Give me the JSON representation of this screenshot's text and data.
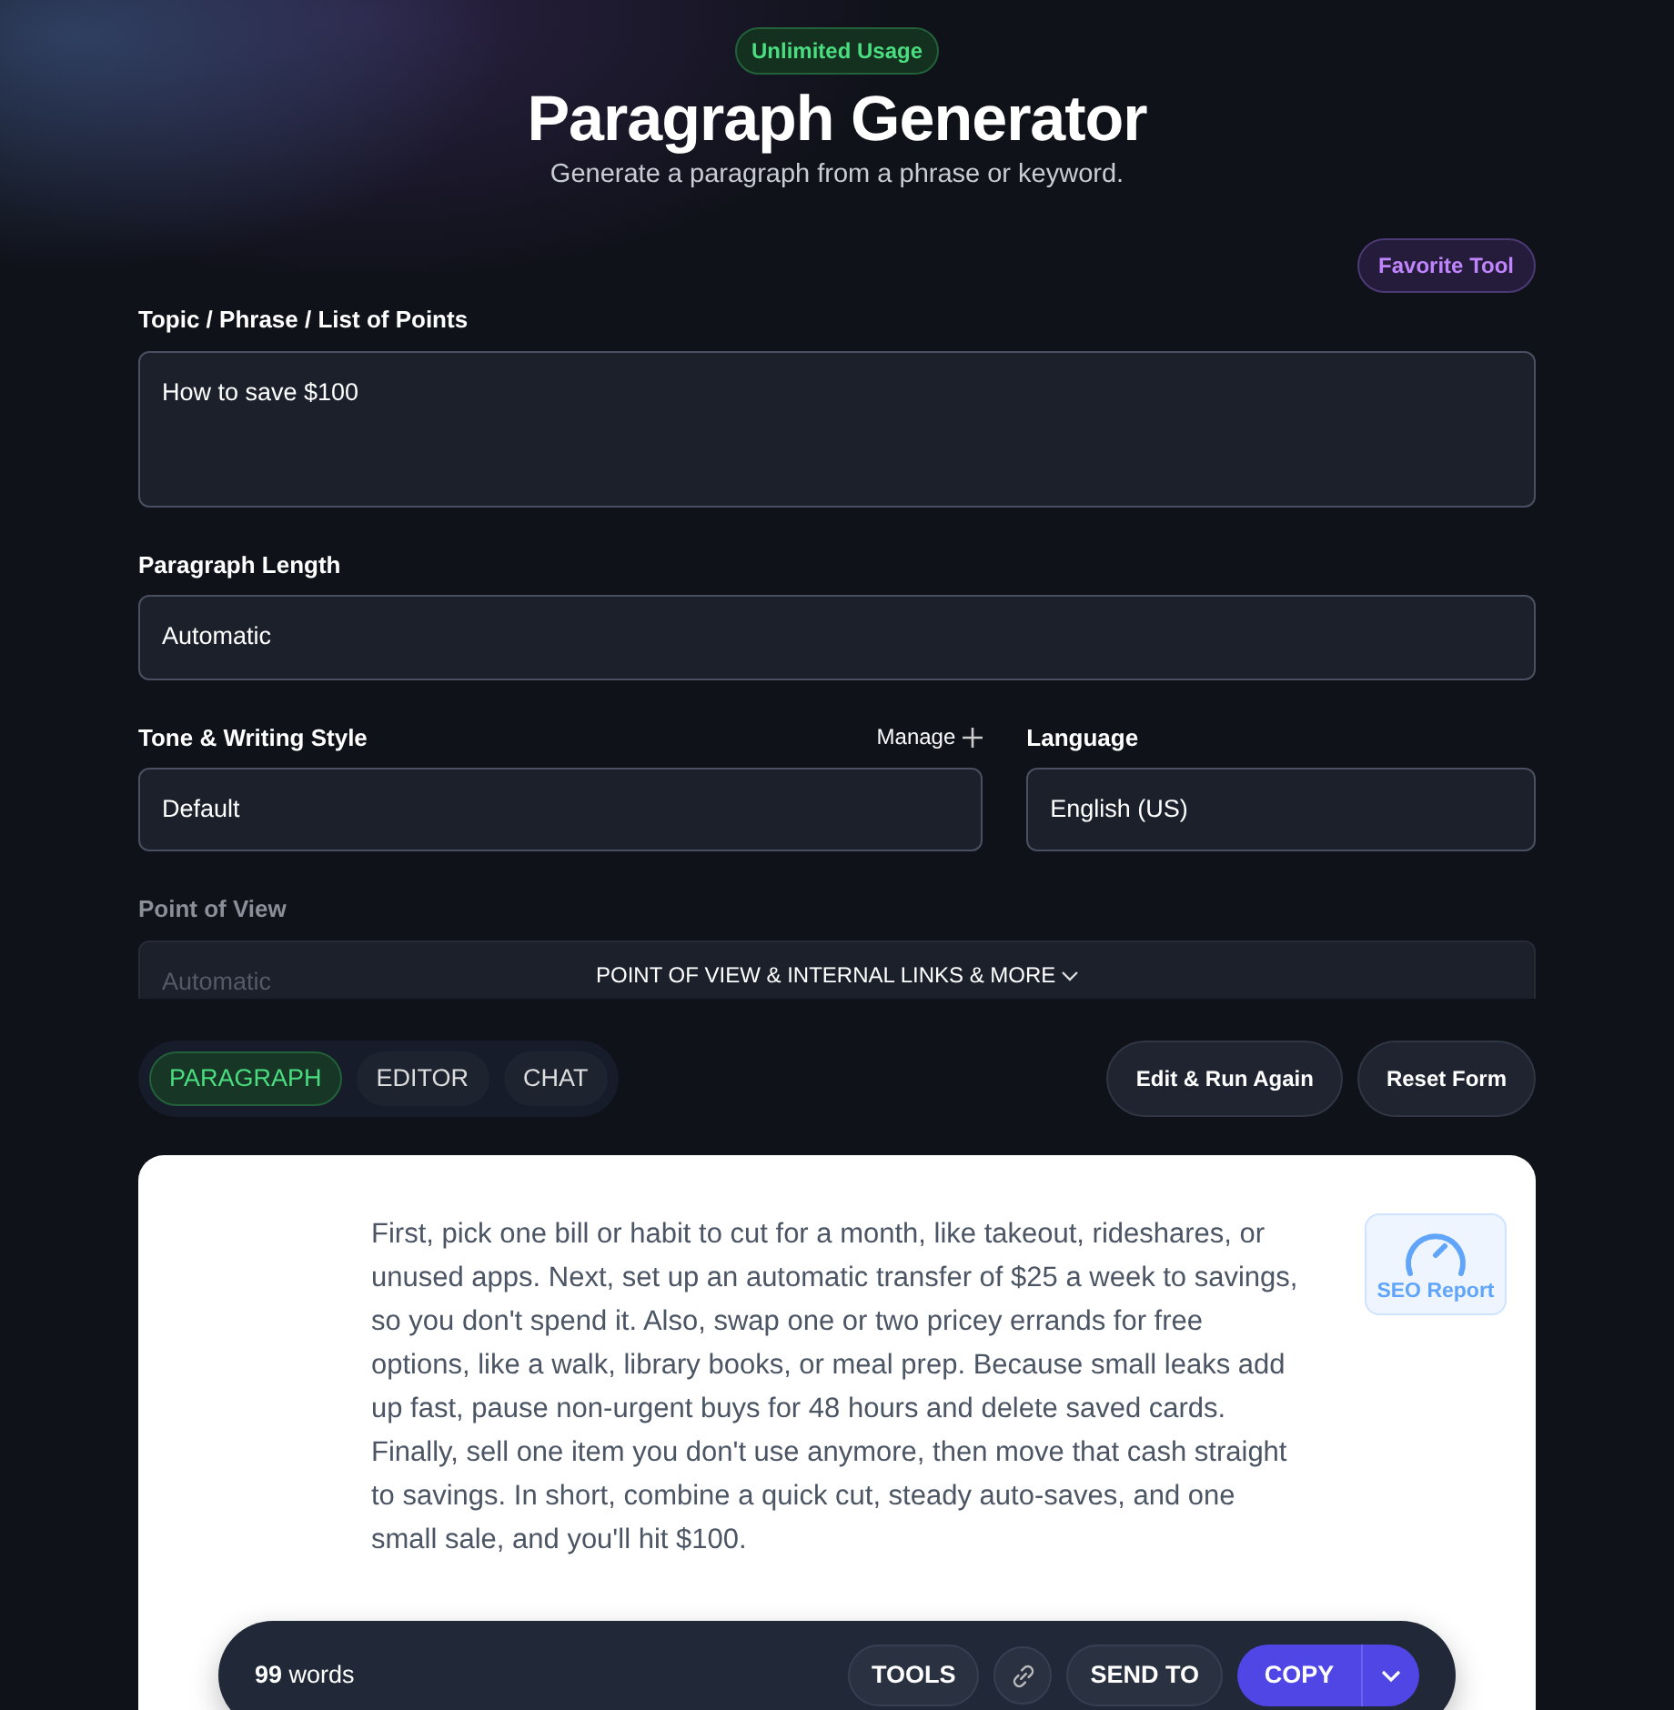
{
  "header": {
    "badge": "Unlimited Usage",
    "title": "Paragraph Generator",
    "subtitle": "Generate a paragraph from a phrase or keyword.",
    "favorite_button": "Favorite Tool"
  },
  "form": {
    "topic": {
      "label": "Topic / Phrase / List of Points",
      "value": "How to save $100"
    },
    "length": {
      "label": "Paragraph Length",
      "value": "Automatic"
    },
    "tone": {
      "label": "Tone & Writing Style",
      "manage": "Manage",
      "value": "Default"
    },
    "language": {
      "label": "Language",
      "value": "English (US)"
    },
    "point_of_view": {
      "label": "Point of View",
      "placeholder": "Automatic"
    },
    "more_toggle": "POINT OF VIEW & INTERNAL LINKS & MORE"
  },
  "tabs": [
    {
      "label": "PARAGRAPH",
      "selected": true
    },
    {
      "label": "EDITOR",
      "selected": false
    },
    {
      "label": "CHAT",
      "selected": false
    }
  ],
  "actions": [
    "Edit & Run Again",
    "Reset Form"
  ],
  "output": {
    "paragraph": "First, pick one bill or habit to cut for a month, like takeout, rideshares, or unused apps. Next, set up an automatic transfer of $25 a week to savings, so you don't spend it. Also, swap one or two pricey errands for free options, like a walk, library books, or meal prep. Because small leaks add up fast, pause non-urgent buys for 48 hours and delete saved cards. Finally, sell one item you don't use anymore, then move that cash straight to savings. In short, combine a quick cut, steady auto-saves, and one small sale, and you'll hit $100.",
    "seo_button": "SEO Report"
  },
  "toolbar": {
    "word_count": "**99** words",
    "tools": "TOOLS",
    "send_to": "SEND TO",
    "copy": "COPY"
  }
}
